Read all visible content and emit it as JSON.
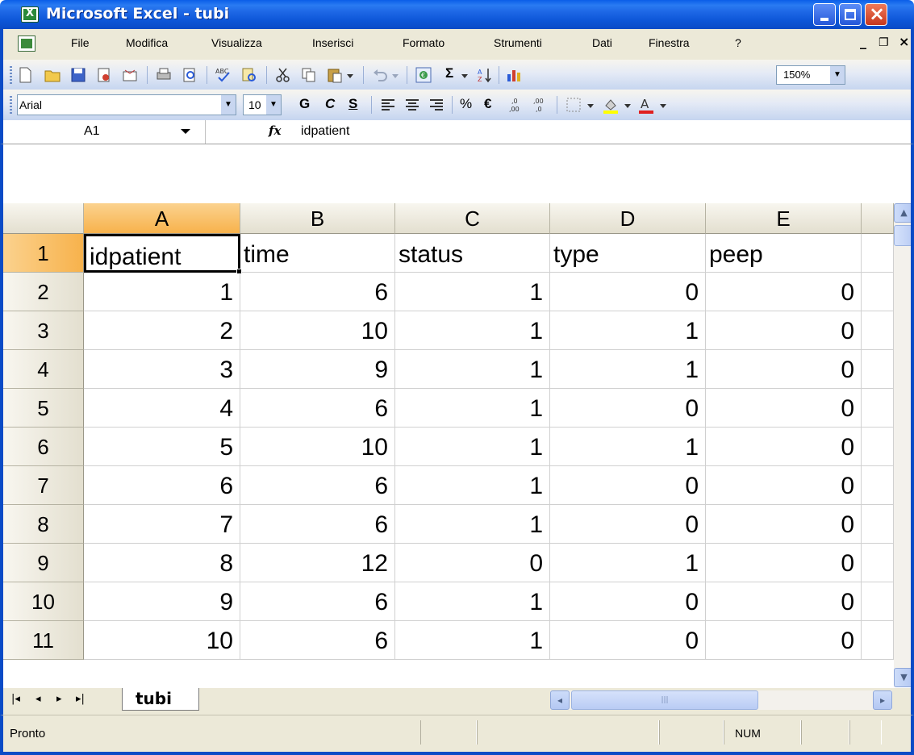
{
  "window": {
    "title": "Microsoft Excel - tubi"
  },
  "menu": {
    "items": [
      "File",
      "Modifica",
      "Visualizza",
      "Inserisci",
      "Formato",
      "Strumenti",
      "Dati",
      "Finestra",
      "?"
    ]
  },
  "toolbar": {
    "zoom": "150%",
    "font_name": "Arial",
    "font_size": "10",
    "bold_label": "G",
    "italic_label": "C",
    "underline_label": "S",
    "percent_label": "%",
    "euro_label": "€",
    "sum_label": "Σ"
  },
  "formula_bar": {
    "name_box": "A1",
    "fx_label": "fx",
    "value": "idpatient"
  },
  "sheet": {
    "columns": [
      "A",
      "B",
      "C",
      "D",
      "E"
    ],
    "rows": [
      "1",
      "2",
      "3",
      "4",
      "5",
      "6",
      "7",
      "8",
      "9",
      "10",
      "11"
    ],
    "header_row": [
      "idpatient",
      "time",
      "status",
      "type",
      "peep"
    ],
    "data": [
      [
        "1",
        "6",
        "1",
        "0",
        "0"
      ],
      [
        "2",
        "10",
        "1",
        "1",
        "0"
      ],
      [
        "3",
        "9",
        "1",
        "1",
        "0"
      ],
      [
        "4",
        "6",
        "1",
        "0",
        "0"
      ],
      [
        "5",
        "10",
        "1",
        "1",
        "0"
      ],
      [
        "6",
        "6",
        "1",
        "0",
        "0"
      ],
      [
        "7",
        "6",
        "1",
        "0",
        "0"
      ],
      [
        "8",
        "12",
        "0",
        "1",
        "0"
      ],
      [
        "9",
        "6",
        "1",
        "0",
        "0"
      ],
      [
        "10",
        "6",
        "1",
        "0",
        "0"
      ]
    ]
  },
  "tabs": {
    "sheet_name": "tubi"
  },
  "status": {
    "text": "Pronto",
    "num": "NUM"
  }
}
